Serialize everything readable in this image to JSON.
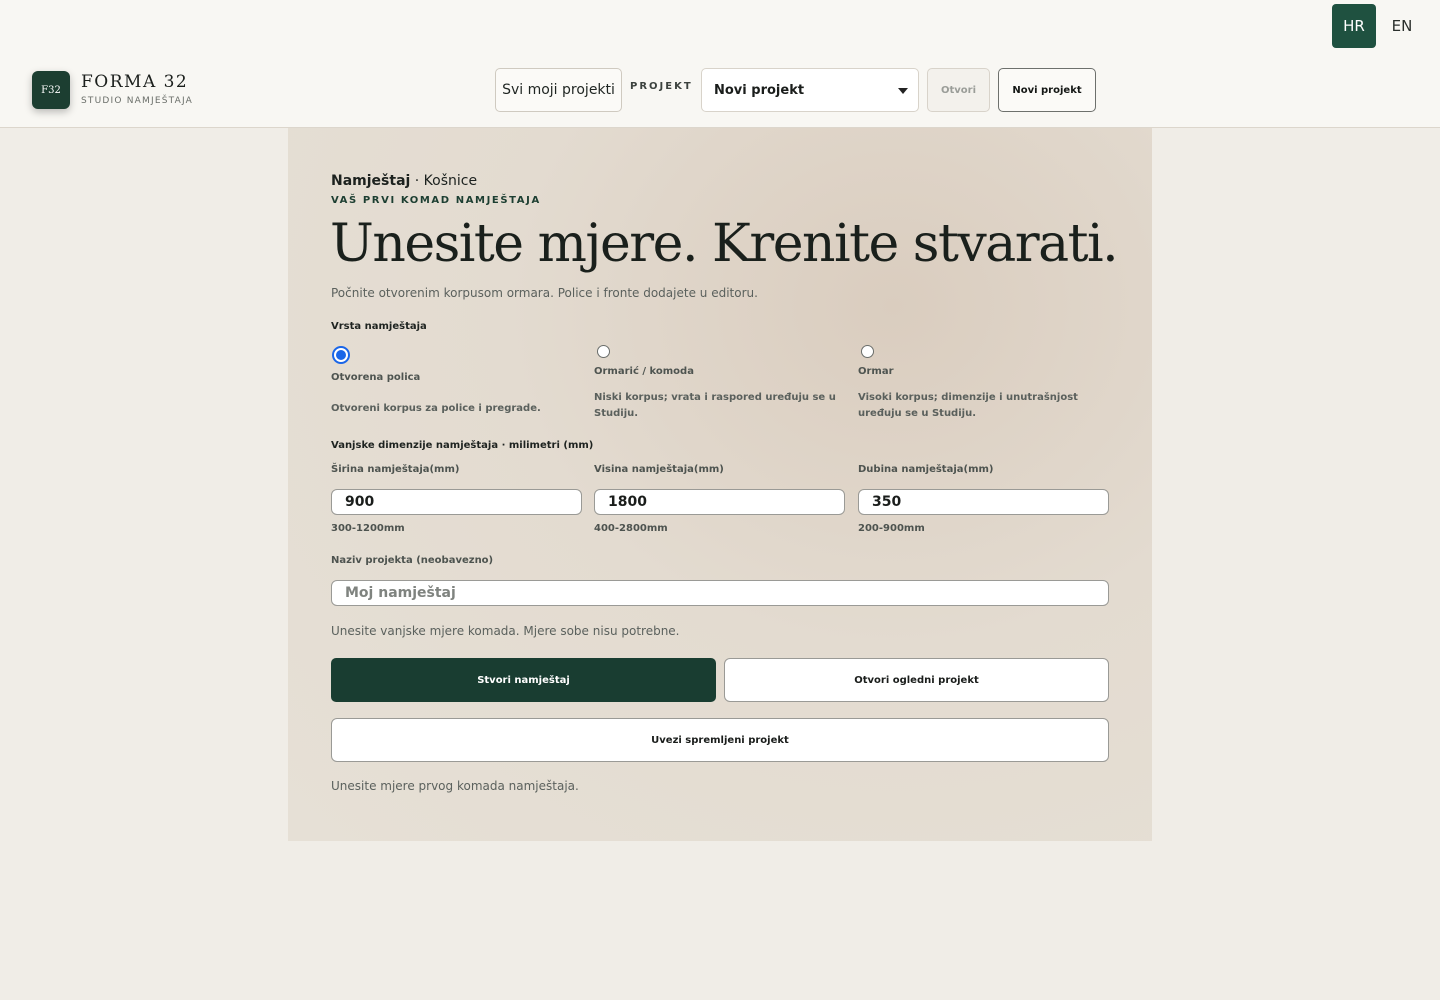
{
  "language": {
    "options": [
      "HR",
      "EN"
    ],
    "active": "HR"
  },
  "brand": {
    "logo_text": "F32",
    "name": "FORMA 32",
    "subtitle": "STUDIO NAMJEŠTAJA"
  },
  "header": {
    "all_projects_label": "Svi moji projekti",
    "project_label": "PROJEKT",
    "project_select_value": "Novi projekt",
    "open_label": "Otvori",
    "new_project_label": "Novi projekt"
  },
  "main": {
    "breadcrumb_bold": "Namještaj",
    "breadcrumb_rest": " · Košnice",
    "eyebrow": "VAŠ PRVI KOMAD NAMJEŠTAJA",
    "headline": "Unesite mjere. Krenite stvarati.",
    "lead": "Počnite otvorenim korpusom ormara. Police i fronte dodajete u editoru.",
    "type_section_label": "Vrsta namještaja",
    "types": [
      {
        "title": "Otvorena polica",
        "desc": "Otvoreni korpus za police i pregrade.",
        "selected": true
      },
      {
        "title": "Ormarić / komoda",
        "desc": "Niski korpus; vrata i raspored uređuju se u Studiju.",
        "selected": false
      },
      {
        "title": "Ormar",
        "desc": "Visoki korpus; dimenzije i unutrašnjost uređuju se u Studiju.",
        "selected": false
      }
    ],
    "dims_section_label": "Vanjske dimenzije namještaja · milimetri (mm)",
    "dims": [
      {
        "label": "Širina namještaja(mm)",
        "value": "900",
        "range": "300-1200mm"
      },
      {
        "label": "Visina namještaja(mm)",
        "value": "1800",
        "range": "400-2800mm"
      },
      {
        "label": "Dubina namještaja(mm)",
        "value": "350",
        "range": "200-900mm"
      }
    ],
    "name_label": "Naziv projekta (neobavezno)",
    "name_placeholder": "Moj namještaj",
    "hint_dims": "Unesite vanjske mjere komada. Mjere sobe nisu potrebne.",
    "create_label": "Stvori namještaj",
    "open_sample_label": "Otvori ogledni projekt",
    "import_label": "Uvezi spremljeni projekt",
    "status": "Unesite mjere prvog komada namještaja."
  }
}
